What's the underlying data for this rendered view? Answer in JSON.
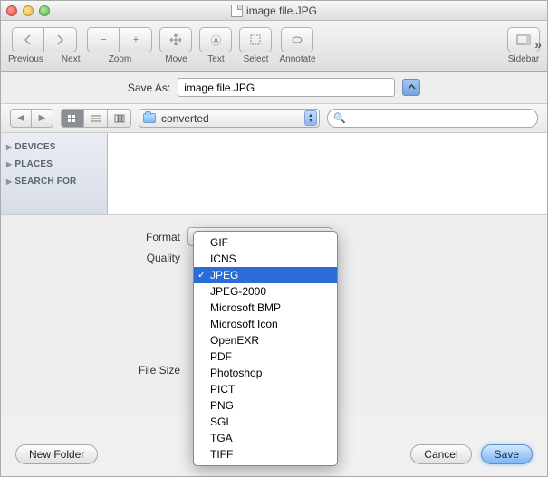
{
  "window": {
    "title": "image file.JPG"
  },
  "toolbar": {
    "previous": "Previous",
    "next": "Next",
    "zoom": "Zoom",
    "move": "Move",
    "text": "Text",
    "select": "Select",
    "annotate": "Annotate",
    "sidebar": "Sidebar"
  },
  "save": {
    "label": "Save As:",
    "filename": "image file.JPG"
  },
  "path": {
    "folder": "converted"
  },
  "search": {
    "placeholder": ""
  },
  "sidebar": {
    "items": [
      {
        "label": "DEVICES"
      },
      {
        "label": "PLACES"
      },
      {
        "label": "SEARCH FOR"
      }
    ]
  },
  "settings": {
    "format_label": "Format",
    "quality_label": "Quality",
    "filesize_label": "File Size"
  },
  "format_menu": {
    "options": [
      "GIF",
      "ICNS",
      "JPEG",
      "JPEG-2000",
      "Microsoft BMP",
      "Microsoft Icon",
      "OpenEXR",
      "PDF",
      "Photoshop",
      "PICT",
      "PNG",
      "SGI",
      "TGA",
      "TIFF"
    ],
    "selected": "JPEG"
  },
  "footer": {
    "new_folder": "New Folder",
    "cancel": "Cancel",
    "save": "Save"
  }
}
